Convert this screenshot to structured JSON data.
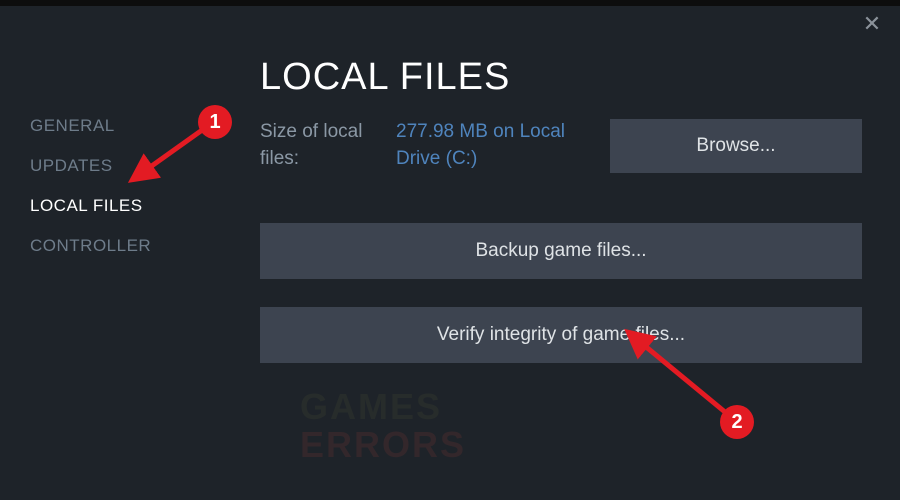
{
  "sidebar": {
    "items": [
      {
        "label": "GENERAL"
      },
      {
        "label": "UPDATES"
      },
      {
        "label": "LOCAL FILES"
      },
      {
        "label": "CONTROLLER"
      }
    ]
  },
  "main": {
    "title": "LOCAL FILES",
    "size_label": "Size of local files:",
    "size_value": "277.98 MB on Local Drive (C:)",
    "browse_label": "Browse...",
    "backup_label": "Backup game files...",
    "verify_label": "Verify integrity of game files..."
  },
  "watermark": {
    "line1": "GAMES",
    "line2": "ERRORS"
  },
  "annotations": {
    "marker1": "1",
    "marker2": "2"
  }
}
